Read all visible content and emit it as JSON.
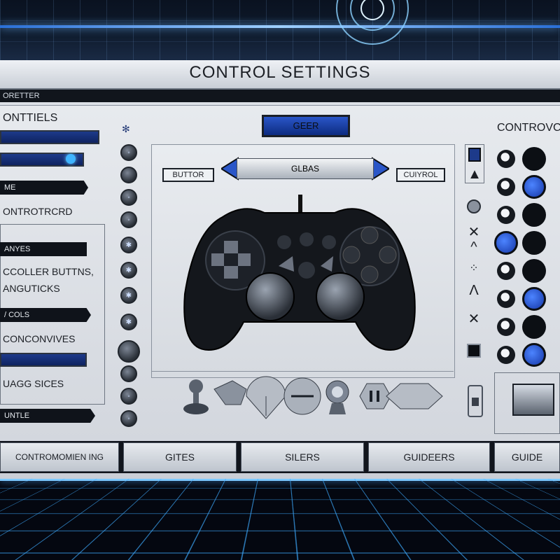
{
  "title": "CONTROL SETTINGS",
  "strip_label": "ORETTER",
  "left": {
    "heading": "ONTTIELS",
    "bars": [
      "",
      ""
    ],
    "arrow_tag_1": "ME",
    "line_1": "ONTROTRCRD",
    "tag_2": "ANYES",
    "line_2": "CCOLLER BUTTNS,",
    "line_3": "ANGUTICKS",
    "tag_3": "/ COLS",
    "line_4": "CONCONVIVES",
    "line_5": "UAGG SICES",
    "tag_4": "UNTLE"
  },
  "center": {
    "gear_button": "GEER",
    "selector_label": "GLBAS",
    "chip_left": "BUTTOR",
    "chip_right": "CUIYROL"
  },
  "right": {
    "heading": "CONTROVC"
  },
  "tabs": [
    "CONTROMOMIEN ING",
    "GITES",
    "SILERS",
    "GUIDEERS",
    "GUIDE"
  ],
  "colors": {
    "accent_blue": "#1d3a8a",
    "button_blue": "#2a56c8",
    "bright_blue": "#4c84ff",
    "panel": "#e7eaee",
    "dark": "#11151c"
  }
}
